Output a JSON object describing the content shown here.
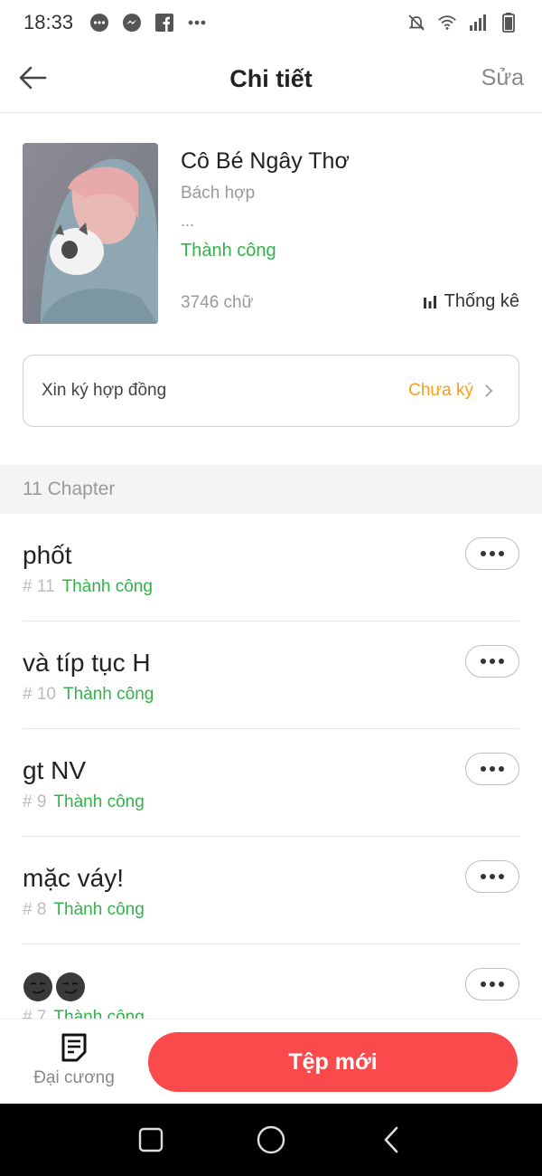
{
  "status_bar": {
    "time": "18:33",
    "left_icons": [
      "chat-bubble-icon",
      "messenger-icon",
      "facebook-icon",
      "more-dots-icon"
    ],
    "right_icons": [
      "muted-bell-icon",
      "wifi-icon",
      "signal-icon",
      "battery-icon"
    ]
  },
  "app_bar": {
    "title": "Chi tiết",
    "edit_label": "Sửa"
  },
  "book": {
    "title": "Cô Bé Ngây Thơ",
    "genre": "Bách hợp",
    "description": "...",
    "status": "Thành công",
    "word_count": "3746 chữ",
    "stats_label": "Thống kê"
  },
  "contract": {
    "label": "Xin ký hợp đồng",
    "status": "Chưa ký"
  },
  "chapters": {
    "header": "11 Chapter",
    "items": [
      {
        "title": "phốt",
        "number": "# 11",
        "status": "Thành công"
      },
      {
        "title": "và típ tục H",
        "number": "# 10",
        "status": "Thành công"
      },
      {
        "title": "gt NV",
        "number": "# 9",
        "status": "Thành công"
      },
      {
        "title": "mặc váy!",
        "number": "# 8",
        "status": "Thành công"
      },
      {
        "title": "",
        "number": "# 7",
        "status": "Thành công"
      }
    ]
  },
  "bottom_bar": {
    "outline_label": "Đại cương",
    "new_file_label": "Tệp mới"
  },
  "colors": {
    "accent_green": "#33b24a",
    "accent_orange": "#f3a019",
    "primary_red": "#fa4a4c"
  }
}
